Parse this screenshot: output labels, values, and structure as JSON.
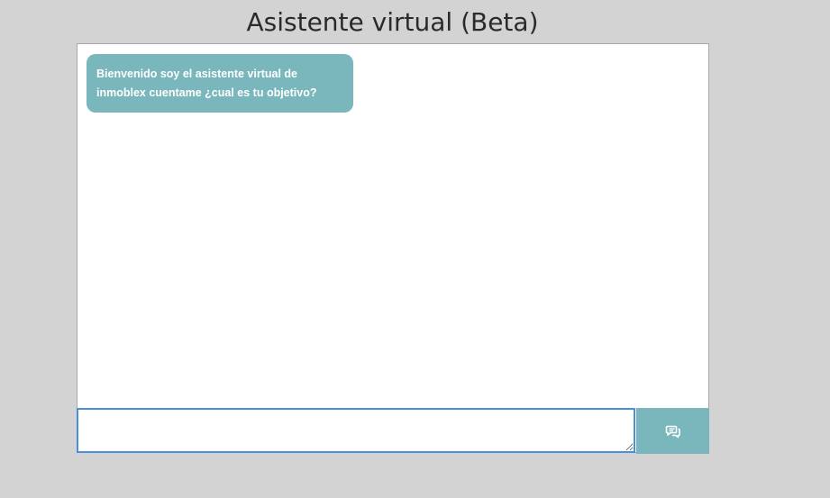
{
  "page": {
    "title": "Asistente virtual (Beta)"
  },
  "chat": {
    "messages": [
      {
        "sender": "bot",
        "text": "Bienvenido soy el asistente virtual de inmoblex cuentame ¿cual es tu objetivo?"
      }
    ]
  },
  "composer": {
    "input_value": "",
    "placeholder": "",
    "send_icon": "chat-bubbles-icon"
  },
  "colors": {
    "background": "#d3d3d3",
    "accent": "#7ab7bd",
    "input_focus_border": "#4a90d9"
  }
}
